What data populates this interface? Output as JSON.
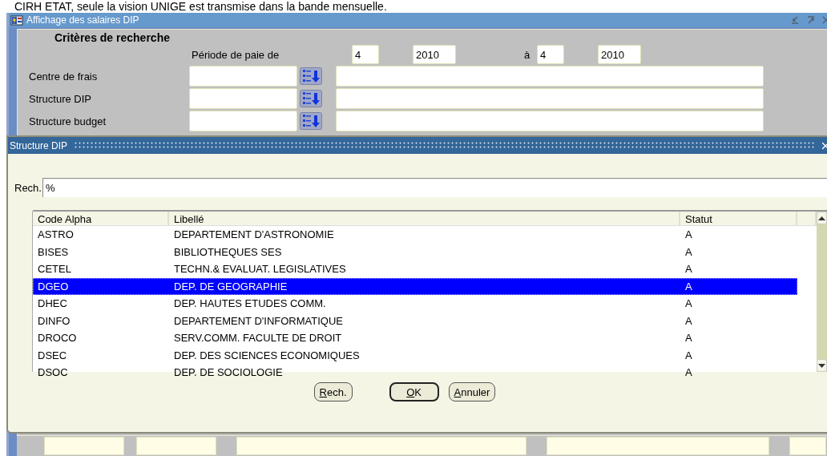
{
  "banner_text": "CIRH ETAT, seule la vision UNIGE est transmise dans la bande mensuelle.",
  "window": {
    "title": "Affichage des salaires DIP"
  },
  "criteria": {
    "heading": "Critères de recherche",
    "period_label": "Période de paie de",
    "from_month": "4",
    "from_year": "2010",
    "to_label": "à",
    "to_month": "4",
    "to_year": "2010",
    "fields": [
      {
        "label": "Centre de frais"
      },
      {
        "label": "Structure DIP"
      },
      {
        "label": "Structure budget"
      }
    ]
  },
  "dialog": {
    "title": "Structure DIP",
    "search_label": "Rech.",
    "search_value": "%",
    "columns": [
      "Code Alpha",
      "Libellé",
      "Statut"
    ],
    "rows": [
      {
        "code": "ASTRO",
        "label": "DEPARTEMENT D'ASTRONOMIE",
        "status": "A",
        "selected": false
      },
      {
        "code": "BISES",
        "label": "BIBLIOTHEQUES SES",
        "status": "A",
        "selected": false
      },
      {
        "code": "CETEL",
        "label": "TECHN.& EVALUAT. LEGISLATIVES",
        "status": "A",
        "selected": false
      },
      {
        "code": "DGEO",
        "label": "DEP. DE GEOGRAPHIE",
        "status": "A",
        "selected": true
      },
      {
        "code": "DHEC",
        "label": "DEP. HAUTES ETUDES COMM.",
        "status": "A",
        "selected": false
      },
      {
        "code": "DINFO",
        "label": "DEPARTEMENT D'INFORMATIQUE",
        "status": "A",
        "selected": false
      },
      {
        "code": "DROCO",
        "label": "SERV.COMM. FACULTE DE DROIT",
        "status": "A",
        "selected": false
      },
      {
        "code": "DSEC",
        "label": "DEP. DES SCIENCES ECONOMIQUES",
        "status": "A",
        "selected": false
      },
      {
        "code": "DSOC",
        "label": "DEP. DE SOCIOLOGIE",
        "status": "A",
        "selected": false
      }
    ],
    "buttons": [
      {
        "mnemonic": "R",
        "label_rest": "ech.",
        "default": false
      },
      {
        "mnemonic": "O",
        "label_rest": "K",
        "default": true
      },
      {
        "mnemonic": "A",
        "label_rest": "nnuler",
        "default": false
      }
    ]
  }
}
